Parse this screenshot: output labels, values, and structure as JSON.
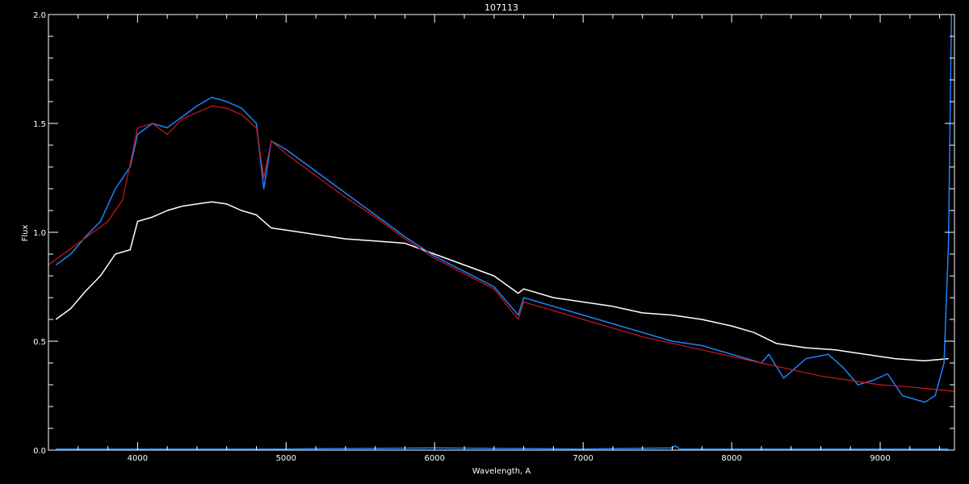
{
  "chart_data": {
    "type": "line",
    "title": "107113",
    "xlabel": "Wavelength, A",
    "ylabel": "Flux",
    "xlim": [
      3400,
      9500
    ],
    "ylim": [
      0.0,
      2.0
    ],
    "x_ticks": [
      4000,
      5000,
      6000,
      7000,
      8000,
      9000
    ],
    "y_ticks": [
      0.0,
      0.5,
      1.0,
      1.5,
      2.0
    ],
    "y_tick_labels": [
      "0.0",
      "0.5",
      "1.0",
      "1.5",
      "2.0"
    ],
    "grid": false,
    "legend": false,
    "colors": {
      "background": "#000000",
      "axes": "#ffffff",
      "white_series": "#ffffff",
      "blue_series": "#1e82ff",
      "red_series": "#d01818"
    },
    "series": [
      {
        "color": "white",
        "x": [
          3450,
          3550,
          3650,
          3750,
          3850,
          3950,
          4000,
          4100,
          4200,
          4300,
          4400,
          4500,
          4600,
          4700,
          4800,
          4900,
          5000,
          5200,
          5400,
          5600,
          5800,
          6000,
          6200,
          6400,
          6563,
          6600,
          6800,
          7000,
          7200,
          7400,
          7600,
          7800,
          8000,
          8150,
          8300,
          8500,
          8700,
          8900,
          9100,
          9300,
          9460
        ],
        "y": [
          0.6,
          0.65,
          0.73,
          0.8,
          0.9,
          0.92,
          1.05,
          1.07,
          1.1,
          1.12,
          1.13,
          1.14,
          1.13,
          1.1,
          1.08,
          1.02,
          1.01,
          0.99,
          0.97,
          0.96,
          0.95,
          0.9,
          0.85,
          0.8,
          0.72,
          0.74,
          0.7,
          0.68,
          0.66,
          0.63,
          0.62,
          0.6,
          0.57,
          0.54,
          0.49,
          0.47,
          0.46,
          0.44,
          0.42,
          0.41,
          0.42
        ]
      },
      {
        "color": "blue",
        "x": [
          3450,
          3550,
          3650,
          3750,
          3850,
          3950,
          4000,
          4100,
          4200,
          4300,
          4400,
          4500,
          4600,
          4700,
          4800,
          4850,
          4900,
          5000,
          5200,
          5400,
          5600,
          5800,
          6000,
          6200,
          6400,
          6563,
          6600,
          6800,
          7000,
          7200,
          7400,
          7600,
          7800,
          8000,
          8200,
          8250,
          8350,
          8500,
          8650,
          8750,
          8850,
          8950,
          9050,
          9150,
          9300,
          9370,
          9430,
          9460,
          9480
        ],
        "y": [
          0.85,
          0.9,
          0.98,
          1.05,
          1.2,
          1.3,
          1.45,
          1.5,
          1.48,
          1.53,
          1.58,
          1.62,
          1.6,
          1.57,
          1.5,
          1.2,
          1.42,
          1.38,
          1.28,
          1.18,
          1.08,
          0.98,
          0.89,
          0.82,
          0.75,
          0.62,
          0.7,
          0.66,
          0.62,
          0.58,
          0.54,
          0.5,
          0.48,
          0.44,
          0.4,
          0.44,
          0.33,
          0.42,
          0.44,
          0.38,
          0.3,
          0.32,
          0.35,
          0.25,
          0.22,
          0.25,
          0.4,
          0.95,
          2.0
        ]
      },
      {
        "color": "red",
        "x": [
          3400,
          3500,
          3600,
          3700,
          3800,
          3900,
          4000,
          4100,
          4200,
          4300,
          4400,
          4500,
          4600,
          4700,
          4800,
          4850,
          4900,
          5000,
          5200,
          5400,
          5600,
          5800,
          6000,
          6200,
          6400,
          6563,
          6600,
          6800,
          7000,
          7200,
          7400,
          7600,
          7800,
          8000,
          8200,
          8400,
          8600,
          8800,
          9000,
          9200,
          9500
        ],
        "y": [
          0.85,
          0.9,
          0.95,
          1.0,
          1.05,
          1.15,
          1.48,
          1.5,
          1.45,
          1.52,
          1.55,
          1.58,
          1.57,
          1.54,
          1.48,
          1.25,
          1.42,
          1.36,
          1.26,
          1.16,
          1.07,
          0.97,
          0.88,
          0.81,
          0.74,
          0.6,
          0.68,
          0.64,
          0.6,
          0.56,
          0.52,
          0.49,
          0.46,
          0.43,
          0.4,
          0.37,
          0.34,
          0.32,
          0.3,
          0.29,
          0.27
        ]
      },
      {
        "color": "blue",
        "x": [
          3450,
          4000,
          5000,
          6000,
          7000,
          7600,
          7620,
          7650,
          8000,
          9000,
          9460
        ],
        "y": [
          0.005,
          0.005,
          0.005,
          0.01,
          0.005,
          0.01,
          0.02,
          0.005,
          0.005,
          0.005,
          0.005
        ]
      }
    ]
  }
}
